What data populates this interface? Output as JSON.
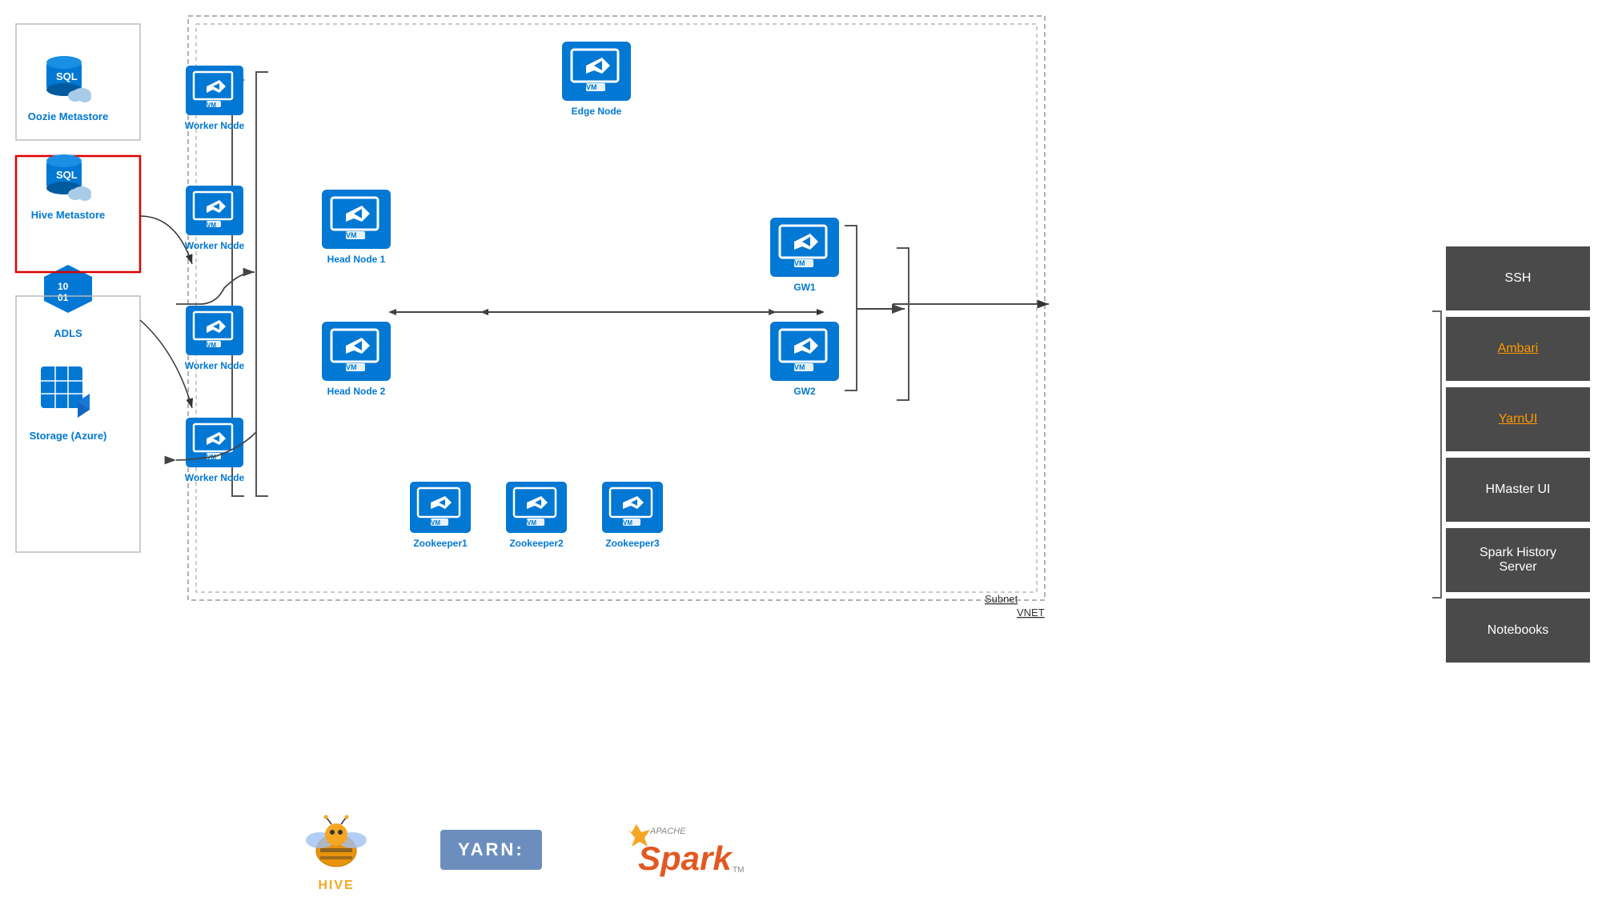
{
  "left": {
    "oozie_label": "Oozie Metastore",
    "hive_label": "Hive Metastore",
    "adls_label": "ADLS",
    "storage_label": "Storage (Azure)"
  },
  "nodes": {
    "worker_label": "Worker Node",
    "vm_label": "VM",
    "head_node1_label": "Head Node 1",
    "head_node2_label": "Head Node 2",
    "edge_node_label": "Edge Node",
    "gw1_label": "GW1",
    "gw2_label": "GW2",
    "zk1_label": "Zookeeper1",
    "zk2_label": "Zookeeper2",
    "zk3_label": "Zookeeper3",
    "subnet_label": "Subnet",
    "vnet_label": "VNET"
  },
  "right_panel": {
    "ssh_label": "SSH",
    "ambari_label": "Ambari",
    "yarn_label": "YarnUI",
    "hmaster_label": "HMaster UI",
    "spark_label": "Spark History\nServer",
    "notebooks_label": "Notebooks"
  },
  "bottom": {
    "hive_text": "HIVE",
    "yarn_text": "YARN:",
    "spark_text": "Spark"
  },
  "colors": {
    "blue": "#0078d4",
    "dark_btn": "#4a4a4a",
    "orange": "#f5a623",
    "white": "#ffffff"
  }
}
